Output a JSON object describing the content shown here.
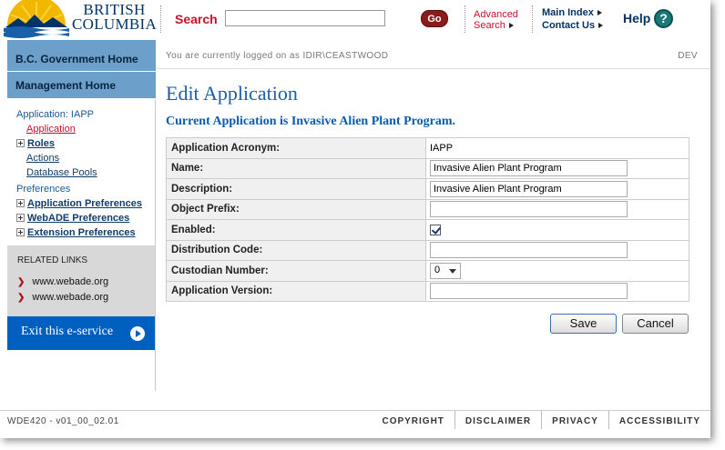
{
  "header": {
    "logo_line1": "BRITISH",
    "logo_line2": "COLUMBIA",
    "search_label": "Search",
    "search_value": "",
    "go_label": "Go",
    "advanced_line1": "Advanced",
    "advanced_line2": "Search",
    "main_index": "Main Index",
    "contact_us": "Contact Us",
    "help": "Help",
    "help_icon_glyph": "?"
  },
  "sidebar": {
    "gov_home": "B.C. Government Home",
    "mgmt_home": "Management Home",
    "app_heading": "Application: IAPP",
    "items": [
      {
        "label": "Application",
        "type": "sub",
        "active": true
      },
      {
        "label": "Roles",
        "type": "plus"
      },
      {
        "label": "Actions",
        "type": "sub"
      },
      {
        "label": "Database Pools",
        "type": "sub"
      }
    ],
    "prefs_heading": "Preferences",
    "pref_items": [
      {
        "label": "Application Preferences"
      },
      {
        "label": "WebADE Preferences"
      },
      {
        "label": "Extension Preferences"
      }
    ],
    "related_title": "RELATED LINKS",
    "related_links": [
      "www.webade.org",
      "www.webade.org"
    ],
    "exit_label": "Exit this e-service"
  },
  "status": {
    "logged_in": "You are currently logged on as IDIR\\CEASTWOOD",
    "env": "DEV"
  },
  "main": {
    "title": "Edit Application",
    "subtitle": "Current Application is Invasive Alien Plant Program.",
    "fields": {
      "acronym_label": "Application Acronym:",
      "acronym_value": "IAPP",
      "name_label": "Name:",
      "name_value": "Invasive Alien Plant Program",
      "description_label": "Description:",
      "description_value": "Invasive Alien Plant Program",
      "object_prefix_label": "Object Prefix:",
      "object_prefix_value": "",
      "enabled_label": "Enabled:",
      "enabled_checked": true,
      "distribution_label": "Distribution Code:",
      "distribution_value": "",
      "custodian_label": "Custodian Number:",
      "custodian_value": "0",
      "version_label": "Application Version:",
      "version_value": ""
    },
    "save_label": "Save",
    "cancel_label": "Cancel"
  },
  "footer": {
    "version": "WDE420 - v01_00_02.01",
    "links": [
      "COPYRIGHT",
      "DISCLAIMER",
      "PRIVACY",
      "ACCESSIBILITY"
    ]
  },
  "colors": {
    "brand_navy": "#003366",
    "nav_blue": "#6c9fc9",
    "exit_blue": "#0060c0",
    "search_red": "#c8102e",
    "title_blue": "#1a5fa8"
  }
}
